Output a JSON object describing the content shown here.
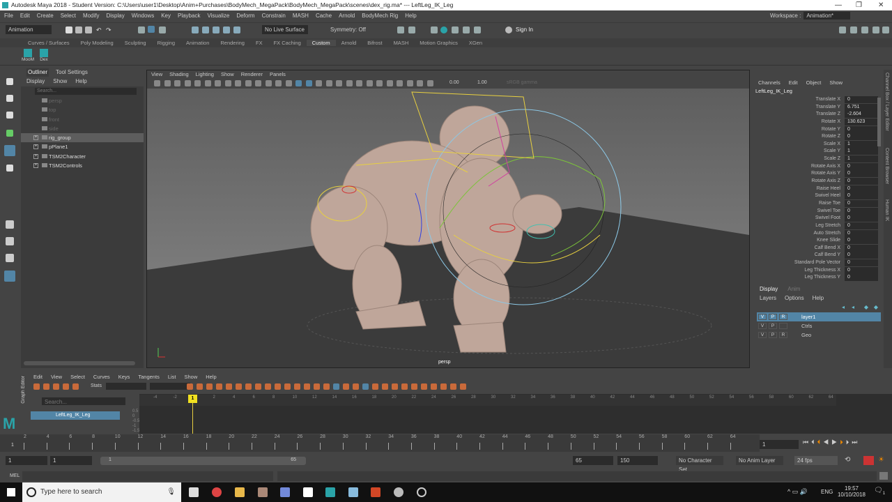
{
  "window": {
    "title": "Autodesk Maya 2018 - Student Version: C:\\Users\\user1\\Desktop\\Anim+Purchases\\BodyMech_MegaPack\\BodyMech_MegaPack\\scenes\\dex_rig.ma*  ---  LeftLeg_IK_Leg"
  },
  "main_menu": [
    "File",
    "Edit",
    "Create",
    "Select",
    "Modify",
    "Display",
    "Windows",
    "Key",
    "Playback",
    "Visualize",
    "Deform",
    "Constrain",
    "MASH",
    "Cache",
    "Arnold",
    "BodyMech Rig",
    "Help"
  ],
  "workspace": {
    "label": "Workspace :",
    "value": "Animation*"
  },
  "status_line": {
    "mode": "Animation",
    "live_surface": "No Live Surface",
    "symmetry": "Symmetry: Off",
    "sign_in": "Sign In"
  },
  "shelf_tabs": [
    "Curves / Surfaces",
    "Poly Modeling",
    "Sculpting",
    "Rigging",
    "Animation",
    "Rendering",
    "FX",
    "FX Caching",
    "Custom",
    "Arnold",
    "Bifrost",
    "MASH",
    "Motion Graphics",
    "XGen"
  ],
  "shelf_active": "Custom",
  "shelf_buttons": [
    "MooM",
    "Dex"
  ],
  "outliner": {
    "tabs": [
      "Outliner",
      "Tool Settings"
    ],
    "menus": [
      "Display",
      "Show",
      "Help"
    ],
    "search_placeholder": "Search...",
    "items": [
      {
        "label": "persp",
        "dim": true
      },
      {
        "label": "top",
        "dim": true
      },
      {
        "label": "front",
        "dim": true
      },
      {
        "label": "side",
        "dim": true
      },
      {
        "label": "rig_group",
        "sel": true
      },
      {
        "label": "pPlane1"
      },
      {
        "label": "TSM2Character"
      },
      {
        "label": "TSM2Controls"
      }
    ]
  },
  "viewport": {
    "menus": [
      "View",
      "Shading",
      "Lighting",
      "Show",
      "Renderer",
      "Panels"
    ],
    "exposure": "0.00",
    "gamma": "1.00",
    "color_space": "sRGB gamma",
    "camera": "persp"
  },
  "channel_box": {
    "menus": [
      "Channels",
      "Edit",
      "Object",
      "Show"
    ],
    "object": "LeftLeg_IK_Leg",
    "attributes": [
      [
        "Translate X",
        "0"
      ],
      [
        "Translate Y",
        "6.751"
      ],
      [
        "Translate Z",
        "-2.604"
      ],
      [
        "Rotate X",
        "130.623"
      ],
      [
        "Rotate Y",
        "0"
      ],
      [
        "Rotate Z",
        "0"
      ],
      [
        "Scale X",
        "1"
      ],
      [
        "Scale Y",
        "1"
      ],
      [
        "Scale Z",
        "1"
      ],
      [
        "Rotate Axis X",
        "0"
      ],
      [
        "Rotate Axis Y",
        "0"
      ],
      [
        "Rotate Axis Z",
        "0"
      ],
      [
        "Raise Heel",
        "0"
      ],
      [
        "Swivel Heel",
        "0"
      ],
      [
        "Raise Toe",
        "0"
      ],
      [
        "Swivel Toe",
        "0"
      ],
      [
        "Swivel Foot",
        "0"
      ],
      [
        "Leg Stretch",
        "0"
      ],
      [
        "Auto Stretch",
        "0"
      ],
      [
        "Knee Slide",
        "0"
      ],
      [
        "Calf Bend X",
        "0"
      ],
      [
        "Calf Bend Y",
        "0"
      ],
      [
        "Standard Pole Vector",
        "0"
      ],
      [
        "Leg Thickness X",
        "0"
      ],
      [
        "Leg Thickness Y",
        "0"
      ]
    ]
  },
  "side_tabs": [
    "Channel Box / Layer Editor",
    "Content Browser",
    "Human IK"
  ],
  "layer_editor": {
    "tabs": [
      "Display",
      "Anim"
    ],
    "menus": [
      "Layers",
      "Options",
      "Help"
    ],
    "layers": [
      {
        "v": "V",
        "p": "P",
        "r": "R",
        "name": "layer1",
        "sel": true
      },
      {
        "v": "V",
        "p": "P",
        "r": "",
        "name": "Ctrls"
      },
      {
        "v": "V",
        "p": "P",
        "r": "R",
        "name": "Geo"
      }
    ]
  },
  "graph_editor": {
    "label": "Graph Editor",
    "menus": [
      "Edit",
      "View",
      "Select",
      "Curves",
      "Keys",
      "Tangents",
      "List",
      "Show",
      "Help"
    ],
    "stats": "Stats",
    "search_placeholder": "Search...",
    "curve": "LeftLeg_IK_Leg",
    "ruler": [
      "-4",
      "-2",
      "0",
      "2",
      "4",
      "6",
      "8",
      "10",
      "12",
      "14",
      "16",
      "18",
      "20",
      "22",
      "24",
      "26",
      "28",
      "30",
      "32",
      "34",
      "36",
      "38",
      "40",
      "42",
      "44",
      "46",
      "48",
      "50",
      "52",
      "54",
      "56",
      "58",
      "60",
      "62",
      "64"
    ],
    "y_labels": [
      "0.5",
      "0",
      "-0.5",
      "-1",
      "-1.5"
    ],
    "current_frame_marker": "1"
  },
  "time_slider": {
    "ticks": [
      "2",
      "4",
      "6",
      "8",
      "10",
      "12",
      "14",
      "16",
      "18",
      "20",
      "22",
      "24",
      "26",
      "28",
      "30",
      "32",
      "34",
      "36",
      "38",
      "40",
      "42",
      "44",
      "46",
      "48",
      "50",
      "52",
      "54",
      "56",
      "58",
      "60",
      "62",
      "64"
    ],
    "current_frame": "1",
    "current_field": "1"
  },
  "range": {
    "start": "1",
    "playback_start": "1",
    "slider_start": "1",
    "slider_end": "65",
    "playback_end": "65",
    "end": "150",
    "character_set": "No Character Set",
    "anim_layer": "No Anim Layer",
    "fps": "24 fps"
  },
  "command_line": {
    "label": "MEL"
  },
  "taskbar": {
    "search": "Type here to search",
    "lang": "ENG",
    "time": "19:57",
    "date": "10/10/2018",
    "notifications": "1"
  }
}
